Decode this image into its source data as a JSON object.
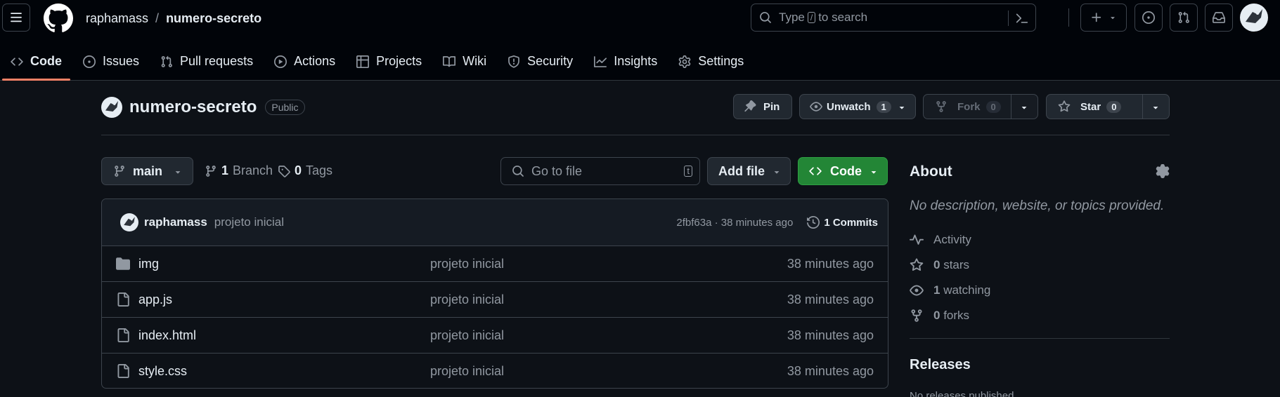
{
  "header": {
    "owner": "raphamass",
    "separator": "/",
    "repo": "numero-secreto",
    "search_prefix": "Type",
    "search_key": "/",
    "search_suffix": "to search"
  },
  "tabs": [
    {
      "label": "Code",
      "icon": "code-icon"
    },
    {
      "label": "Issues",
      "icon": "issue-icon"
    },
    {
      "label": "Pull requests",
      "icon": "pull-request-icon"
    },
    {
      "label": "Actions",
      "icon": "play-icon"
    },
    {
      "label": "Projects",
      "icon": "table-icon"
    },
    {
      "label": "Wiki",
      "icon": "book-icon"
    },
    {
      "label": "Security",
      "icon": "shield-icon"
    },
    {
      "label": "Insights",
      "icon": "graph-icon"
    },
    {
      "label": "Settings",
      "icon": "gear-icon"
    }
  ],
  "repo_header": {
    "name": "numero-secreto",
    "visibility": "Public",
    "pin_label": "Pin",
    "unwatch_label": "Unwatch",
    "watch_count": "1",
    "fork_label": "Fork",
    "fork_count": "0",
    "star_label": "Star",
    "star_count": "0"
  },
  "toolbar": {
    "branch": "main",
    "branches_count": "1",
    "branches_label": "Branch",
    "tags_count": "0",
    "tags_label": "Tags",
    "goto_placeholder": "Go to file",
    "goto_key": "t",
    "add_file_label": "Add file",
    "code_label": "Code"
  },
  "latest_commit": {
    "author": "raphamass",
    "message": "projeto inicial",
    "sha_time": "2fbf63a · 38 minutes ago",
    "commits_label": "1 Commits"
  },
  "files": [
    {
      "name": "img",
      "type": "folder",
      "message": "projeto inicial",
      "time": "38 minutes ago"
    },
    {
      "name": "app.js",
      "type": "file",
      "message": "projeto inicial",
      "time": "38 minutes ago"
    },
    {
      "name": "index.html",
      "type": "file",
      "message": "projeto inicial",
      "time": "38 minutes ago"
    },
    {
      "name": "style.css",
      "type": "file",
      "message": "projeto inicial",
      "time": "38 minutes ago"
    }
  ],
  "about": {
    "title": "About",
    "description": "No description, website, or topics provided.",
    "activity_label": "Activity",
    "stars_count": "0",
    "stars_label": "stars",
    "watching_count": "1",
    "watching_label": "watching",
    "forks_count": "0",
    "forks_label": "forks",
    "releases_title": "Releases",
    "releases_sub": "No releases published"
  },
  "colors": {
    "accent_tab": "#f78166",
    "code_button": "#238636",
    "background": "#0d1117",
    "header_bg": "#010409"
  }
}
